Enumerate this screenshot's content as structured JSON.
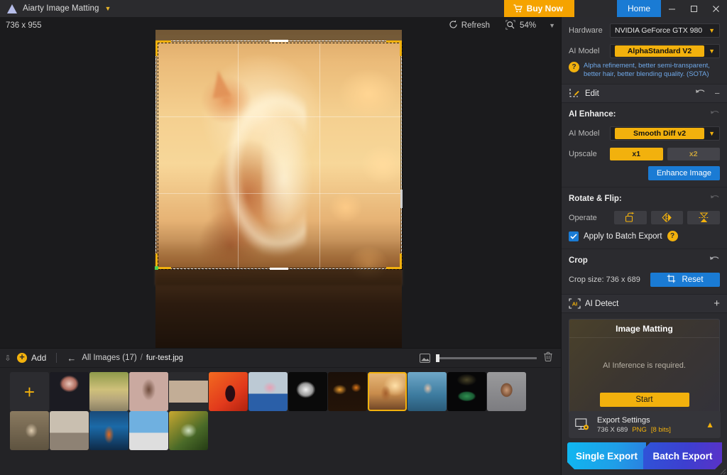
{
  "titlebar": {
    "app_title": "Aiarty Image Matting",
    "logo_icon": "triangle-logo-icon",
    "dropdown_icon": "chevron-down-icon",
    "buy_now": "Buy Now",
    "cart_icon": "cart-icon",
    "home_tab": "Home",
    "minimize": "—",
    "maximize": "☐",
    "close": "✕"
  },
  "canvas": {
    "image_dimensions": "736 x 955",
    "refresh_label": "Refresh",
    "refresh_icon": "refresh-icon",
    "zoom_icon": "magnifier-icon",
    "zoom_level": "54%",
    "zoom_chevron": "chevron-down-icon"
  },
  "filmstrip": {
    "collapse_icon": "chevrons-down-icon",
    "add_label": "Add",
    "add_icon": "plus-circle-icon",
    "back_icon": "arrow-left-icon",
    "breadcrumb_all": "All Images (17)",
    "breadcrumb_sep": "/",
    "breadcrumb_file": "fur-test.jpg",
    "thumb_size_icon": "image-size-icon",
    "delete_icon": "trash-icon",
    "add_tile_icon": "plus-icon",
    "thumbnails": [
      {
        "name": "jellyfish",
        "selected": false
      },
      {
        "name": "bicycle",
        "selected": false
      },
      {
        "name": "woman-blossoms",
        "selected": false
      },
      {
        "name": "blonde-portrait",
        "selected": false
      },
      {
        "name": "red-silhouette",
        "selected": false
      },
      {
        "name": "pink-hair-woman",
        "selected": false
      },
      {
        "name": "white-hand",
        "selected": false
      },
      {
        "name": "fire-scene",
        "selected": false
      },
      {
        "name": "fur-test-kitten",
        "selected": true
      },
      {
        "name": "blue-robed-woman",
        "selected": false
      },
      {
        "name": "emerald-necklace",
        "selected": false
      },
      {
        "name": "bearded-man",
        "selected": false
      },
      {
        "name": "child-portrait",
        "selected": false
      },
      {
        "name": "interior-scene",
        "selected": false
      },
      {
        "name": "neon-figure",
        "selected": false
      },
      {
        "name": "bmx-jump",
        "selected": false
      },
      {
        "name": "spider-web",
        "selected": false
      }
    ]
  },
  "panel": {
    "hardware": {
      "label": "Hardware",
      "value": "NVIDIA GeForce GTX 980",
      "chevron": "chevron-down-icon"
    },
    "ai_model_top": {
      "label": "AI Model",
      "value": "AlphaStandard  V2",
      "chevron": "chevron-down-icon",
      "help_icon": "question-icon",
      "hint": "Alpha refinement, better semi-transparent, better hair, better blending quality. (SOTA)"
    },
    "edit": {
      "icon": "edit-crop-icon",
      "title": "Edit",
      "undo_icon": "undo-icon",
      "minimize_icon": "minus-icon"
    },
    "ai_enhance": {
      "title": "AI Enhance:",
      "undo_icon": "undo-icon",
      "model_label": "AI Model",
      "model_value": "Smooth Diff v2",
      "model_chevron": "chevron-down-icon",
      "upscale_label": "Upscale",
      "upscale_x1": "x1",
      "upscale_x2": "x2",
      "enhance_button": "Enhance Image"
    },
    "rotate_flip": {
      "title": "Rotate & Flip:",
      "undo_icon": "undo-icon",
      "operate_label": "Operate",
      "rotate_icon": "rotate-icon",
      "flip_h_icon": "flip-horizontal-icon",
      "flip_v_icon": "flip-vertical-icon",
      "batch_label": "Apply to Batch Export",
      "batch_checked": true,
      "batch_check_icon": "check-icon",
      "batch_help_icon": "question-icon"
    },
    "crop": {
      "title": "Crop",
      "undo_icon": "undo-icon",
      "size_label": "Crop size: 736 x 689",
      "reset_button": "Reset",
      "reset_icon": "crop-icon"
    },
    "ai_detect": {
      "icon": "ai-bracket-icon",
      "title": "AI Detect",
      "add_icon": "plus-icon",
      "card_title": "Image Matting",
      "card_message": "AI Inference is required.",
      "start_button": "Start"
    },
    "export": {
      "icon": "export-settings-icon",
      "title": "Export Settings",
      "size": "736 X 689",
      "format": "PNG",
      "bits": "[8 bits]",
      "collapse_icon": "chevron-up-icon",
      "single_export": "Single Export",
      "batch_export": "Batch Export"
    }
  },
  "colors": {
    "accent_yellow": "#f2b10d",
    "accent_blue": "#1a7bd4",
    "buy_orange": "#f5a300",
    "hint_blue": "#6fa8e8",
    "panel_bg": "#2b2b2f"
  }
}
